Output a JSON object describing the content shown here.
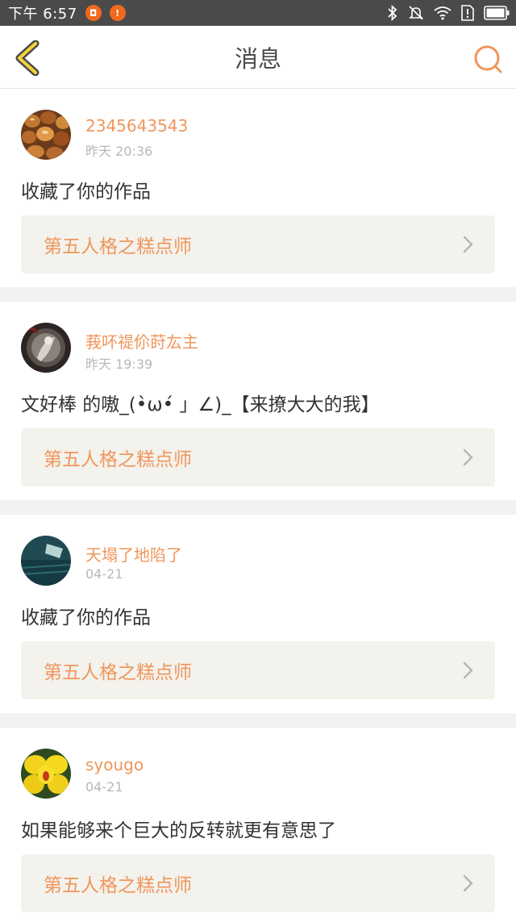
{
  "status_bar": {
    "time": "下午 6:57",
    "notif1_icon": "app-notification-icon",
    "notif2_icon": "alert-notification-icon",
    "icons": [
      "bluetooth-icon",
      "mute-icon",
      "wifi-icon",
      "sim-alert-icon",
      "battery-icon"
    ],
    "bg_color": "#4a4a4a"
  },
  "header": {
    "title": "消息",
    "back_icon": "chevron-left-icon",
    "search_icon": "search-icon",
    "accent_color": "#f0965c"
  },
  "messages": [
    {
      "username": "2345643543",
      "time": "昨天 20:36",
      "text": "收藏了你的作品",
      "work_title": "第五人格之糕点师",
      "avatar": "chestnuts"
    },
    {
      "username": "莪吥禔伱莳厷主",
      "time": "昨天 19:39",
      "text": "文好棒 的嗷_(•̀ω•́ 」∠)_【来撩大大的我】",
      "work_title": "第五人格之糕点师",
      "avatar": "dark-character"
    },
    {
      "username": "天塌了地陷了",
      "time": "04-21",
      "text": "收藏了你的作品",
      "work_title": "第五人格之糕点师",
      "avatar": "teal-fabric"
    },
    {
      "username": "syougo",
      "time": "04-21",
      "text": "如果能够来个巨大的反转就更有意思了",
      "work_title": "第五人格之糕点师",
      "avatar": "yellow-flower"
    }
  ]
}
